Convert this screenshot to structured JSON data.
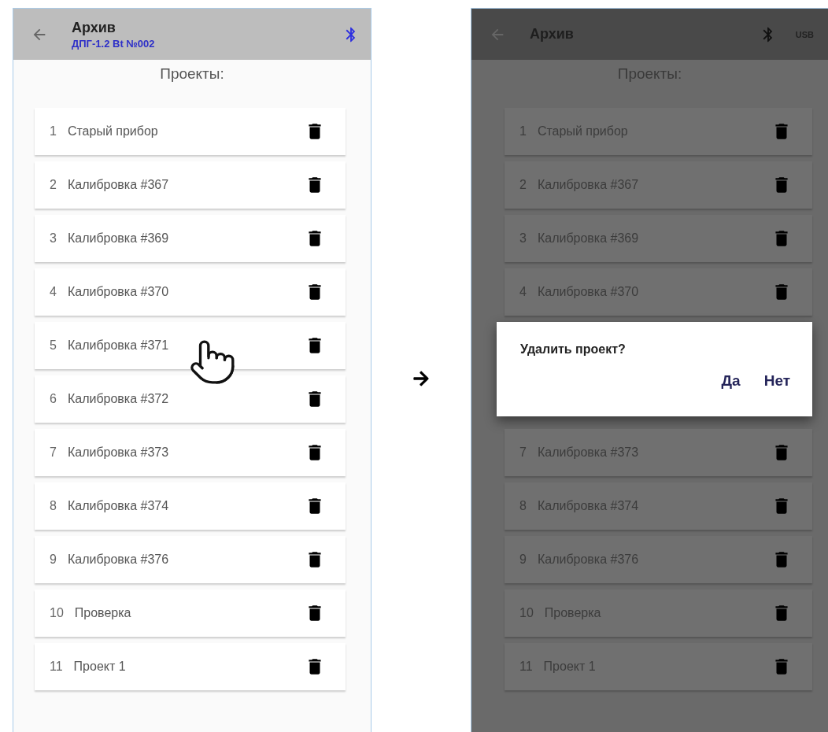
{
  "left_screen": {
    "dimmed": false,
    "header": {
      "title": "Архив",
      "subtitle": "ДПГ-1.2 Bt №002"
    },
    "heading": "Проекты:",
    "projects": [
      {
        "number": "1",
        "name": "Старый прибор"
      },
      {
        "number": "2",
        "name": "Калибровка #367"
      },
      {
        "number": "3",
        "name": "Калибровка #369"
      },
      {
        "number": "4",
        "name": "Калибровка #370"
      },
      {
        "number": "5",
        "name": "Калибровка #371"
      },
      {
        "number": "6",
        "name": "Калибровка #372"
      },
      {
        "number": "7",
        "name": "Калибровка #373"
      },
      {
        "number": "8",
        "name": "Калибровка #374"
      },
      {
        "number": "9",
        "name": "Калибровка #376"
      },
      {
        "number": "10",
        "name": "Проверка"
      },
      {
        "number": "11",
        "name": "Проект 1"
      }
    ]
  },
  "right_screen": {
    "dimmed": true,
    "header": {
      "title": "Архив",
      "usb": "USB"
    },
    "heading": "Проекты:",
    "projects_above": [
      {
        "number": "1",
        "name": "Старый прибор"
      },
      {
        "number": "2",
        "name": "Калибровка #367"
      },
      {
        "number": "3",
        "name": "Калибровка #369"
      },
      {
        "number": "4",
        "name": "Калибровка #370"
      }
    ],
    "dialog": {
      "message": "Удалить проект?",
      "buttons": [
        "Да",
        "Нет"
      ]
    },
    "projects_below": [
      {
        "number": "7",
        "name": "Калибровка #373"
      },
      {
        "number": "8",
        "name": "Калибровка #374"
      },
      {
        "number": "9",
        "name": "Калибровка #376"
      },
      {
        "number": "10",
        "name": "Проверка"
      },
      {
        "number": "11",
        "name": "Проект 1"
      }
    ]
  }
}
